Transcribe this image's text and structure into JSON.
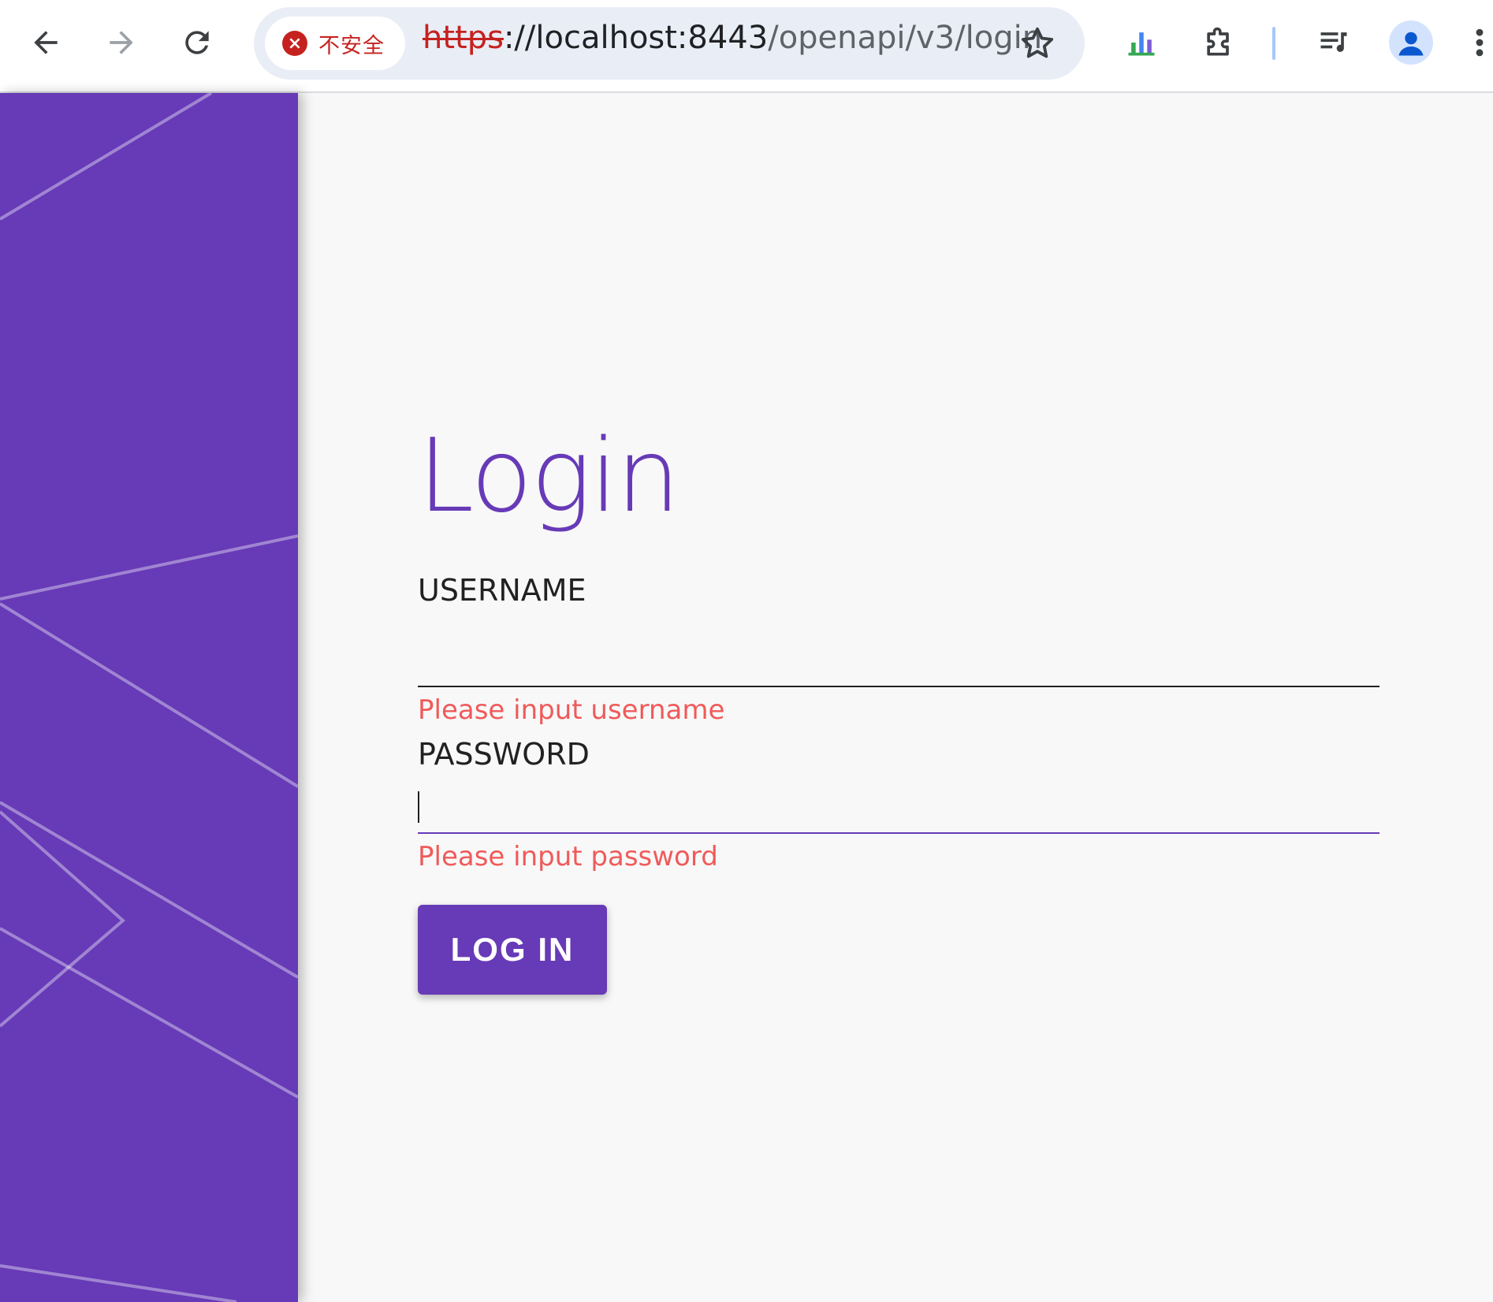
{
  "browser": {
    "security_label": "不安全",
    "url": {
      "scheme": "https",
      "host": "://localhost:8443",
      "path": "/openapi/v3/login"
    },
    "icons": {
      "back": "arrow-left-icon",
      "forward": "arrow-right-icon",
      "reload": "reload-icon",
      "security": "error-circle-icon",
      "bookmark": "star-outline-icon",
      "extension_chart": "bar-chart-extension-icon",
      "extensions": "puzzle-piece-icon",
      "media": "queue-music-icon",
      "profile": "person-icon",
      "menu": "three-dots-vertical-icon"
    }
  },
  "login": {
    "title": "Login",
    "username_label": "USERNAME",
    "username_value": "",
    "username_error": "Please input username",
    "password_label": "PASSWORD",
    "password_value": "",
    "password_error": "Please input password",
    "submit_label": "LOG IN"
  },
  "colors": {
    "primary": "#673ab7",
    "error": "#f05a5a",
    "insecure": "#c5221f",
    "background": "#f8f8f8"
  }
}
